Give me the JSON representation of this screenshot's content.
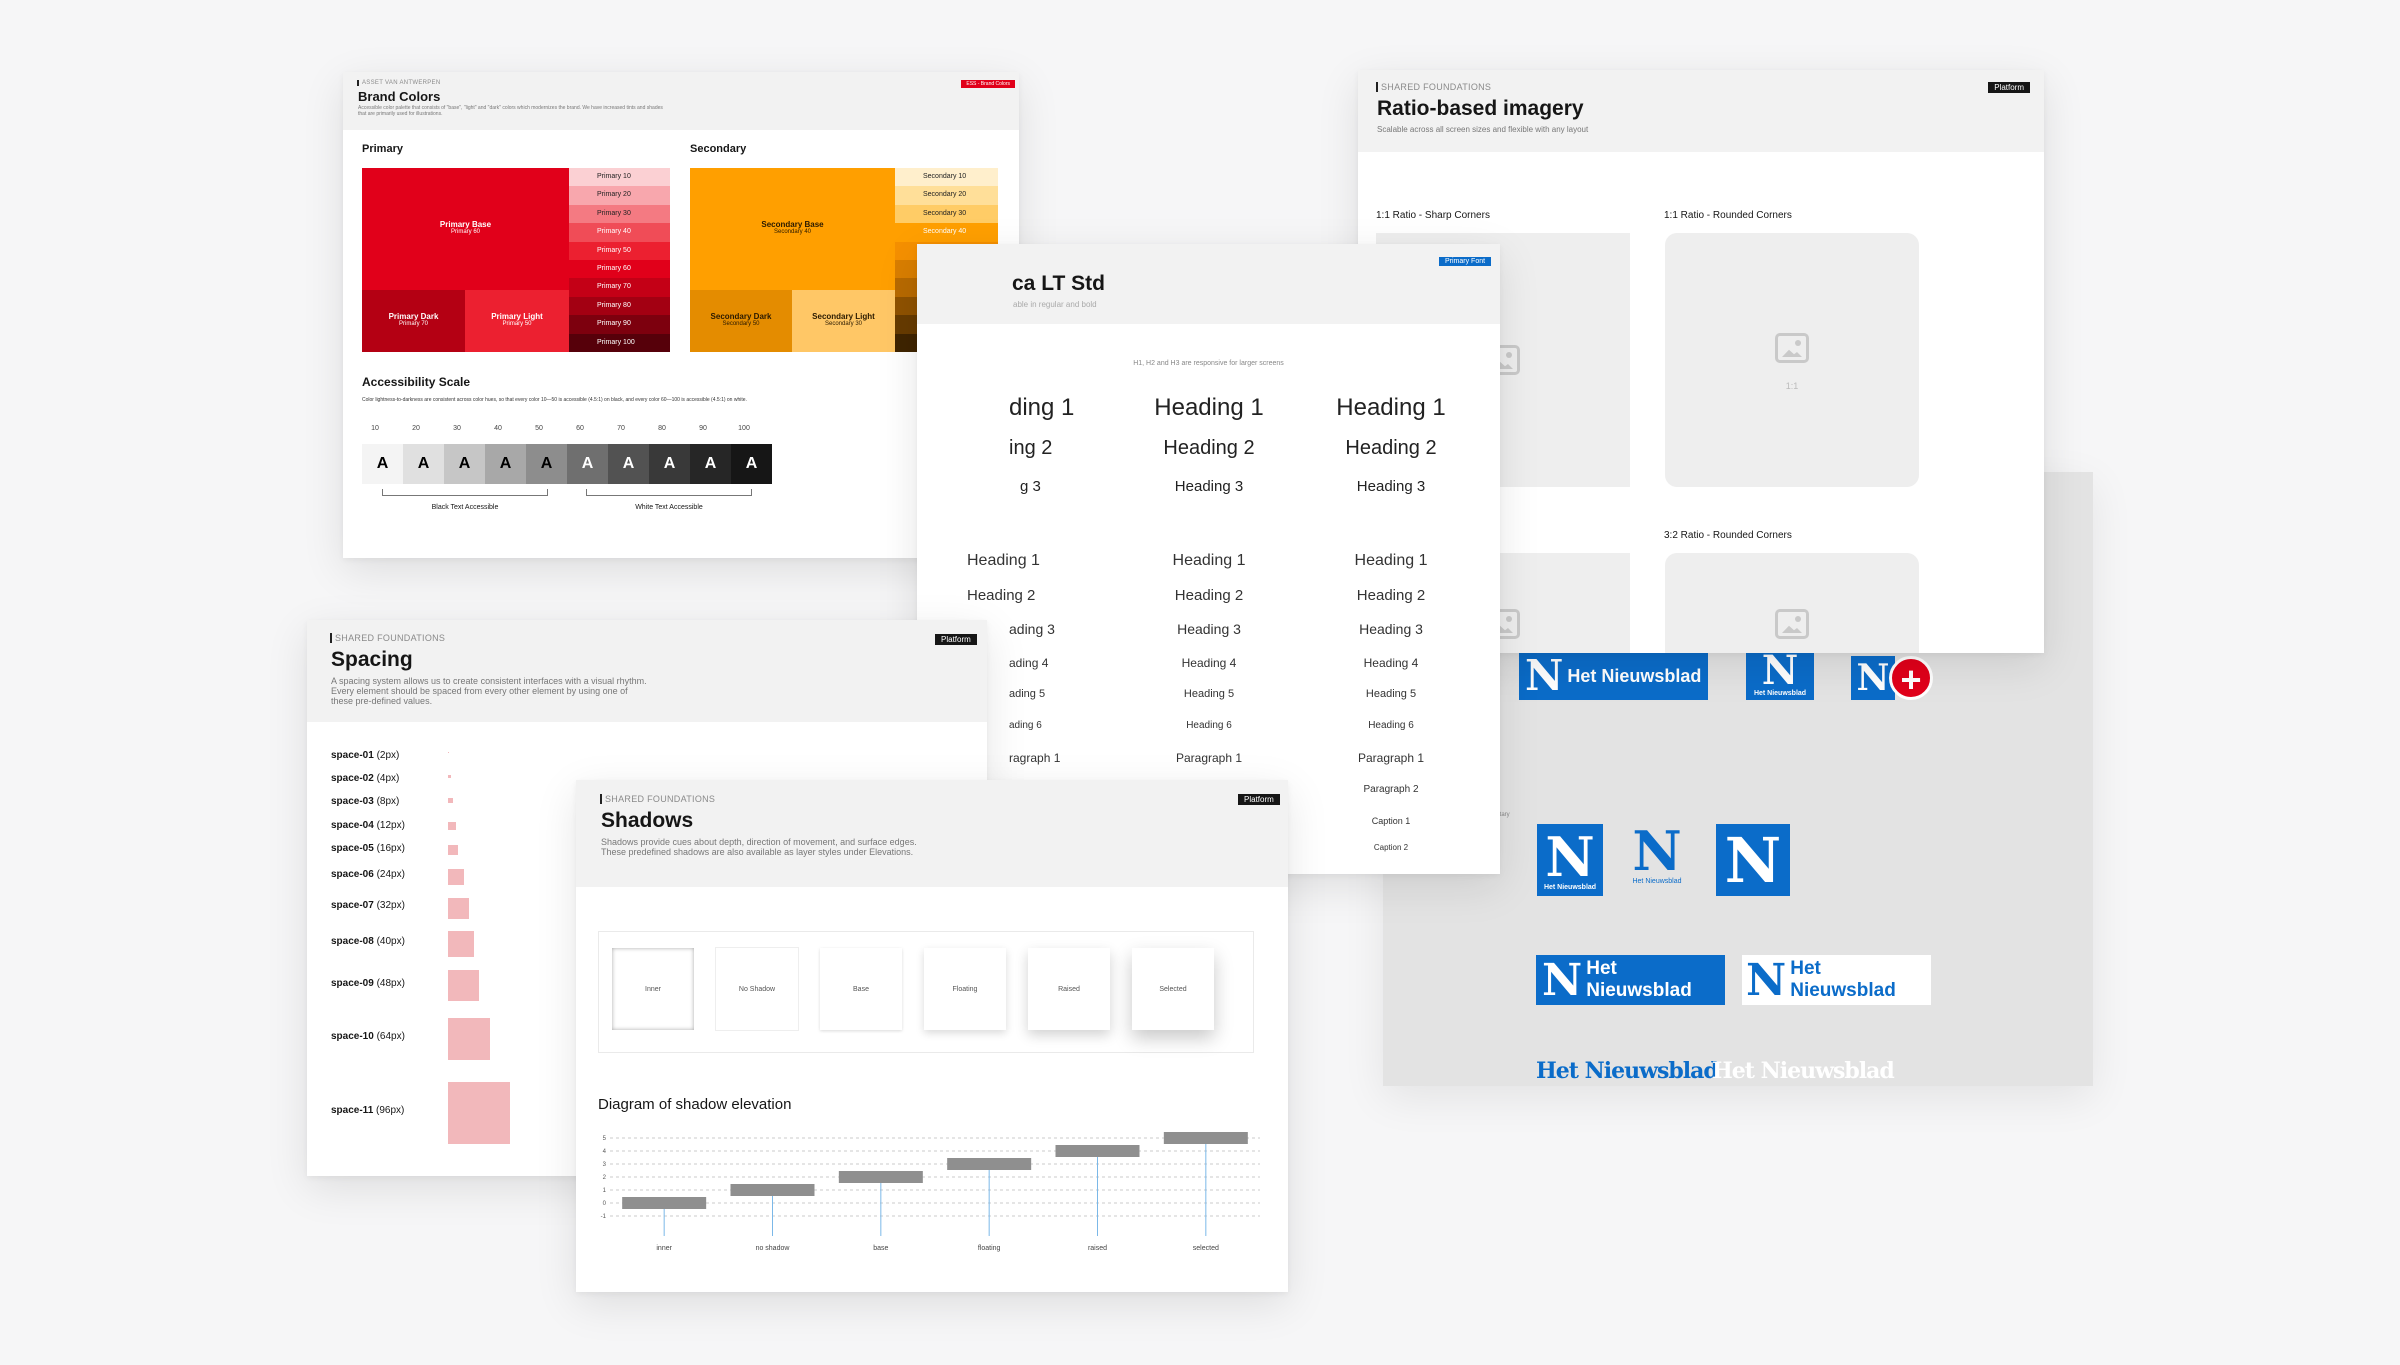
{
  "brand": {
    "eyebrow": "ASSET VAN ANTWERPEN",
    "title": "Brand Colors",
    "desc": "Accessible color palette that consists of \"base\", \"light\" and \"dark\" colors which modernizes the brand. We have increased tints and shades that are primarily used for illustrations.",
    "tag": "ESS - Brand Colors",
    "primary_label": "Primary",
    "secondary_label": "Secondary",
    "primary_base": "Primary Base",
    "primary_base_sub": "Primary 60",
    "primary_dark": "Primary Dark",
    "primary_dark_sub": "Primary 70",
    "primary_light": "Primary Light",
    "primary_light_sub": "Primary 50",
    "primary_scale": [
      "Primary 10",
      "Primary 20",
      "Primary 30",
      "Primary 40",
      "Primary 50",
      "Primary 60",
      "Primary 70",
      "Primary 80",
      "Primary 90",
      "Primary 100"
    ],
    "primary_colors": [
      "#fbd0d3",
      "#f8a7ad",
      "#f47a82",
      "#f04c57",
      "#ec2030",
      "#e1001a",
      "#c40016",
      "#a30012",
      "#7d000e",
      "#56000a"
    ],
    "secondary_base": "Secondary Base",
    "secondary_base_sub": "Secondary 40",
    "secondary_dark": "Secondary Dark",
    "secondary_dark_sub": "Secondary 50",
    "secondary_light": "Secondary Light",
    "secondary_light_sub": "Secondary 30",
    "secondary_scale": [
      "Secondary 10",
      "Secondary 20",
      "Secondary 30",
      "Secondary 40",
      "Secondary 50",
      "Secondary 60",
      "Secondary 70",
      "Secondary 80",
      "Secondary 90",
      "Secondary 100"
    ],
    "secondary_colors": [
      "#ffefcc",
      "#ffdf99",
      "#ffcc66",
      "#ff9f00",
      "#f59000",
      "#d97e00",
      "#b86a00",
      "#8f5200",
      "#673b00",
      "#3f2400"
    ],
    "access_title": "Accessibility Scale",
    "access_desc": "Color lightness-to-darkness are consistent across color hues, so that every color 10—50 is accessible (4.5:1) on black, and every color 60—100 is accessible (4.5:1) on white.",
    "ticks": [
      "10",
      "20",
      "30",
      "40",
      "50",
      "60",
      "70",
      "80",
      "90",
      "100"
    ],
    "letter": "A",
    "black_label": "Black Text Accessible",
    "white_label": "White Text Accessible"
  },
  "imagery": {
    "eyebrow": "SHARED FOUNDATIONS",
    "title": "Ratio-based imagery",
    "desc": "Scalable across all screen sizes and flexible with any layout",
    "tag": "Platform",
    "label_sharp": "1:1 Ratio - Sharp Corners",
    "label_rounded": "1:1 Ratio - Rounded Corners",
    "label_32": "3:2 Ratio - Rounded Corners",
    "ratio": "1:1"
  },
  "typo": {
    "title": "ca LT Std",
    "desc": "able in regular and bold",
    "tag": "Primary Font",
    "note": "H1, H2 and H3 are responsive for larger screens",
    "big": [
      "Heading 1",
      "Heading 2",
      "Heading 3"
    ],
    "small": [
      "Heading 1",
      "Heading 2",
      "Heading 3",
      "Heading 4",
      "Heading 5",
      "Heading 6",
      "Paragraph 1",
      "Paragraph 2",
      "Caption 1",
      "Caption 2"
    ],
    "left_big": [
      "ding 1",
      "ing 2",
      "g 3"
    ],
    "left_small": [
      "Heading 1",
      "Heading 2",
      "ading 3",
      "ading 4",
      "ading 5",
      "ading 6",
      "ragraph 1"
    ]
  },
  "spacing": {
    "eyebrow": "SHARED FOUNDATIONS",
    "title": "Spacing",
    "desc": "A spacing system allows us to create consistent interfaces with a visual rhythm. Every element should be spaced from every other element by using one of these pre-defined values.",
    "tag": "Platform",
    "items": [
      {
        "name": "space-01",
        "px": "(2px)",
        "size": 2
      },
      {
        "name": "space-02",
        "px": "(4px)",
        "size": 4
      },
      {
        "name": "space-03",
        "px": "(8px)",
        "size": 8
      },
      {
        "name": "space-04",
        "px": "(12px)",
        "size": 12
      },
      {
        "name": "space-05",
        "px": "(16px)",
        "size": 16
      },
      {
        "name": "space-06",
        "px": "(24px)",
        "size": 24
      },
      {
        "name": "space-07",
        "px": "(32px)",
        "size": 32
      },
      {
        "name": "space-08",
        "px": "(40px)",
        "size": 40
      },
      {
        "name": "space-09",
        "px": "(48px)",
        "size": 48
      },
      {
        "name": "space-10",
        "px": "(64px)",
        "size": 64
      },
      {
        "name": "space-11",
        "px": "(96px)",
        "size": 96
      }
    ],
    "color": "#f2b8bb"
  },
  "shadows": {
    "eyebrow": "SHARED FOUNDATIONS",
    "title": "Shadows",
    "desc": "Shadows provide cues about depth, direction of movement, and surface edges. These predefined shadows are also available as layer styles under Elevations.",
    "tag": "Platform",
    "boxes": [
      "Inner",
      "No Shadow",
      "Base",
      "Floating",
      "Raised",
      "Selected"
    ],
    "diagram_title": "Diagram of shadow elevation"
  },
  "chart_data": {
    "type": "bar",
    "categories": [
      "inner",
      "no shadow",
      "base",
      "floating",
      "raised",
      "selected"
    ],
    "values": [
      -1,
      0,
      1,
      2,
      3,
      4
    ],
    "yticks": [
      "5",
      "4",
      "3",
      "2",
      "1",
      "0",
      "-1"
    ],
    "ylim": [
      -1,
      5
    ],
    "title": "Diagram of shadow elevation",
    "bar_color": "#8f8f8f",
    "line_color": "#7bb8e8"
  },
  "logos": {
    "wordmark": "Het Nieuwsblad",
    "letter": "N",
    "secondary_label": "entary",
    "blue": "#0b6cc9"
  }
}
